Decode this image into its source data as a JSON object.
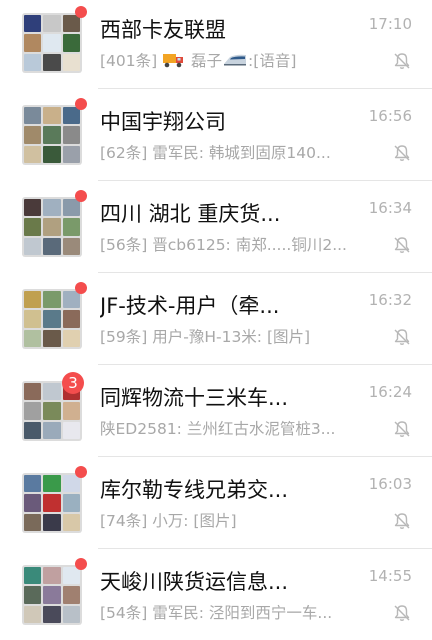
{
  "chats": [
    {
      "title": "西部卡友联盟",
      "time": "17:10",
      "preview_prefix": "[401条] ",
      "preview_emoji1": "truck-emoji",
      "preview_mid": " 磊子",
      "preview_emoji2": "train-emoji",
      "preview_suffix": ":[语音]",
      "unread_dot": true,
      "muted": true,
      "avatar_colors": [
        "#2f3f7a",
        "#c8c8c8",
        "#6a5a4a",
        "#b08860",
        "#dfe8f0",
        "#3a6a3a",
        "#b9c9d9",
        "#4a4a4a",
        "#e8e0d0"
      ]
    },
    {
      "title": "中国宇翔公司",
      "time": "16:56",
      "preview": "[62条] 雷军民: 韩城到固原140...",
      "unread_dot": true,
      "muted": true,
      "avatar_colors": [
        "#7a8a9a",
        "#c9b08a",
        "#4a6a8a",
        "#a08a6a",
        "#5a7a5a",
        "#8a8a8a",
        "#d0c0a0",
        "#3a5a3a",
        "#9aa0aa"
      ]
    },
    {
      "title": "四川 湖北 重庆货...",
      "time": "16:34",
      "preview": "[56条] 晋cb6125: 南郑.....铜川2...",
      "unread_dot": true,
      "muted": true,
      "avatar_colors": [
        "#4a3a3a",
        "#a0b0c0",
        "#8a9aaa",
        "#6a7a4a",
        "#b0a080",
        "#7a9a6a",
        "#c0c8d0",
        "#5a6a7a",
        "#9a8a7a"
      ]
    },
    {
      "title": "JF-技术-用户（牵...",
      "time": "16:32",
      "preview": "[59条] 用户-豫H-13米: [图片]",
      "unread_dot": true,
      "muted": true,
      "avatar_colors": [
        "#c0a050",
        "#7a9a6a",
        "#a0b0c0",
        "#d0c090",
        "#5a7a8a",
        "#8a6a5a",
        "#b0c0a0",
        "#6a5a4a",
        "#e0d0b0"
      ]
    },
    {
      "title": "同辉物流十三米车...",
      "time": "16:24",
      "preview": "陕ED2581: 兰州红古水泥管桩3...",
      "unread_count": "3",
      "muted": true,
      "avatar_colors": [
        "#8a6a5a",
        "#c0c8d0",
        "#b03030",
        "#a0a0a0",
        "#7a8a5a",
        "#d0b090",
        "#4a5a6a",
        "#9aaaba",
        "#e8e8ee"
      ]
    },
    {
      "title": "库尔勒专线兄弟交...",
      "time": "16:03",
      "preview": "[74条] 小万: [图片]",
      "unread_dot": true,
      "muted": true,
      "avatar_colors": [
        "#5a7aa0",
        "#3a9a4a",
        "#d0d8e8",
        "#6a5a7a",
        "#c03030",
        "#9ab0c0",
        "#7a6a5a",
        "#3a3a4a",
        "#d8c8a8"
      ]
    },
    {
      "title": "天峻川陕货运信息...",
      "time": "14:55",
      "preview": "[54条] 雷军民: 泾阳到西宁一车...",
      "unread_dot": true,
      "muted": true,
      "avatar_colors": [
        "#3a8a7a",
        "#c0a0a0",
        "#e0e8f0",
        "#5a6a5a",
        "#8a7a9a",
        "#a08070",
        "#d0c8b8",
        "#4a4a5a",
        "#b8c0c8"
      ]
    }
  ],
  "icons": {
    "mute": "bell-muted-icon"
  },
  "colors": {
    "badge": "#f44d4d",
    "title": "#111111",
    "subtle": "#a8a8a8"
  }
}
